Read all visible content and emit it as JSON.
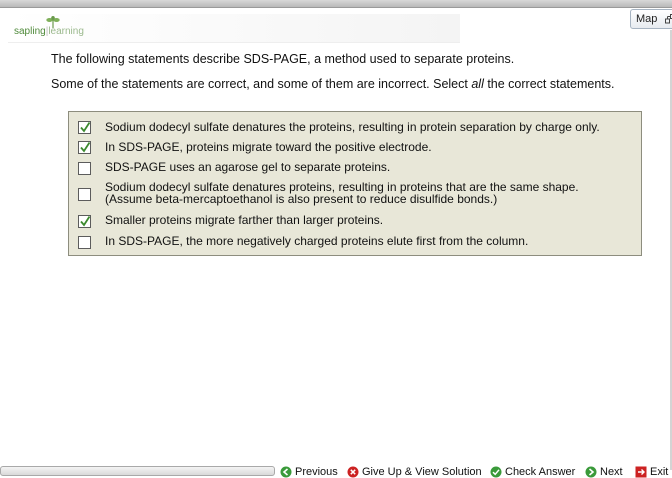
{
  "header": {
    "logo_sapling": "sapling",
    "logo_sep": "|",
    "logo_learning": "learning",
    "map_label": "Map"
  },
  "question": {
    "intro1": "The following statements describe SDS-PAGE, a method used to separate proteins.",
    "intro2_pre": "Some of the statements are correct, and some of them are incorrect. Select ",
    "intro2_em": "all",
    "intro2_post": " the correct statements."
  },
  "options": [
    {
      "text": "Sodium dodecyl sulfate denatures the proteins, resulting in protein separation by charge only.",
      "checked": true
    },
    {
      "text": "In SDS-PAGE, proteins migrate toward the positive electrode.",
      "checked": true
    },
    {
      "text": "SDS-PAGE uses an agarose gel to separate proteins.",
      "checked": false
    },
    {
      "text_line1": "Sodium dodecyl sulfate denatures proteins, resulting in proteins that are the same shape.",
      "text_line2": "(Assume beta-mercaptoethanol is also present to reduce disulfide bonds.)",
      "checked": false
    },
    {
      "text": "Smaller proteins migrate farther than larger proteins.",
      "checked": true
    },
    {
      "text": "In SDS-PAGE, the more negatively charged proteins elute first from the column.",
      "checked": false
    }
  ],
  "nav": {
    "previous": "Previous",
    "give_up": "Give Up & View Solution",
    "check": "Check Answer",
    "next": "Next",
    "exit": "Exit"
  },
  "colors": {
    "options_bg": "#e8e7d8",
    "check_green": "#3c8a2e",
    "nav_green": "#3a9a3a",
    "nav_red": "#cc2222"
  }
}
